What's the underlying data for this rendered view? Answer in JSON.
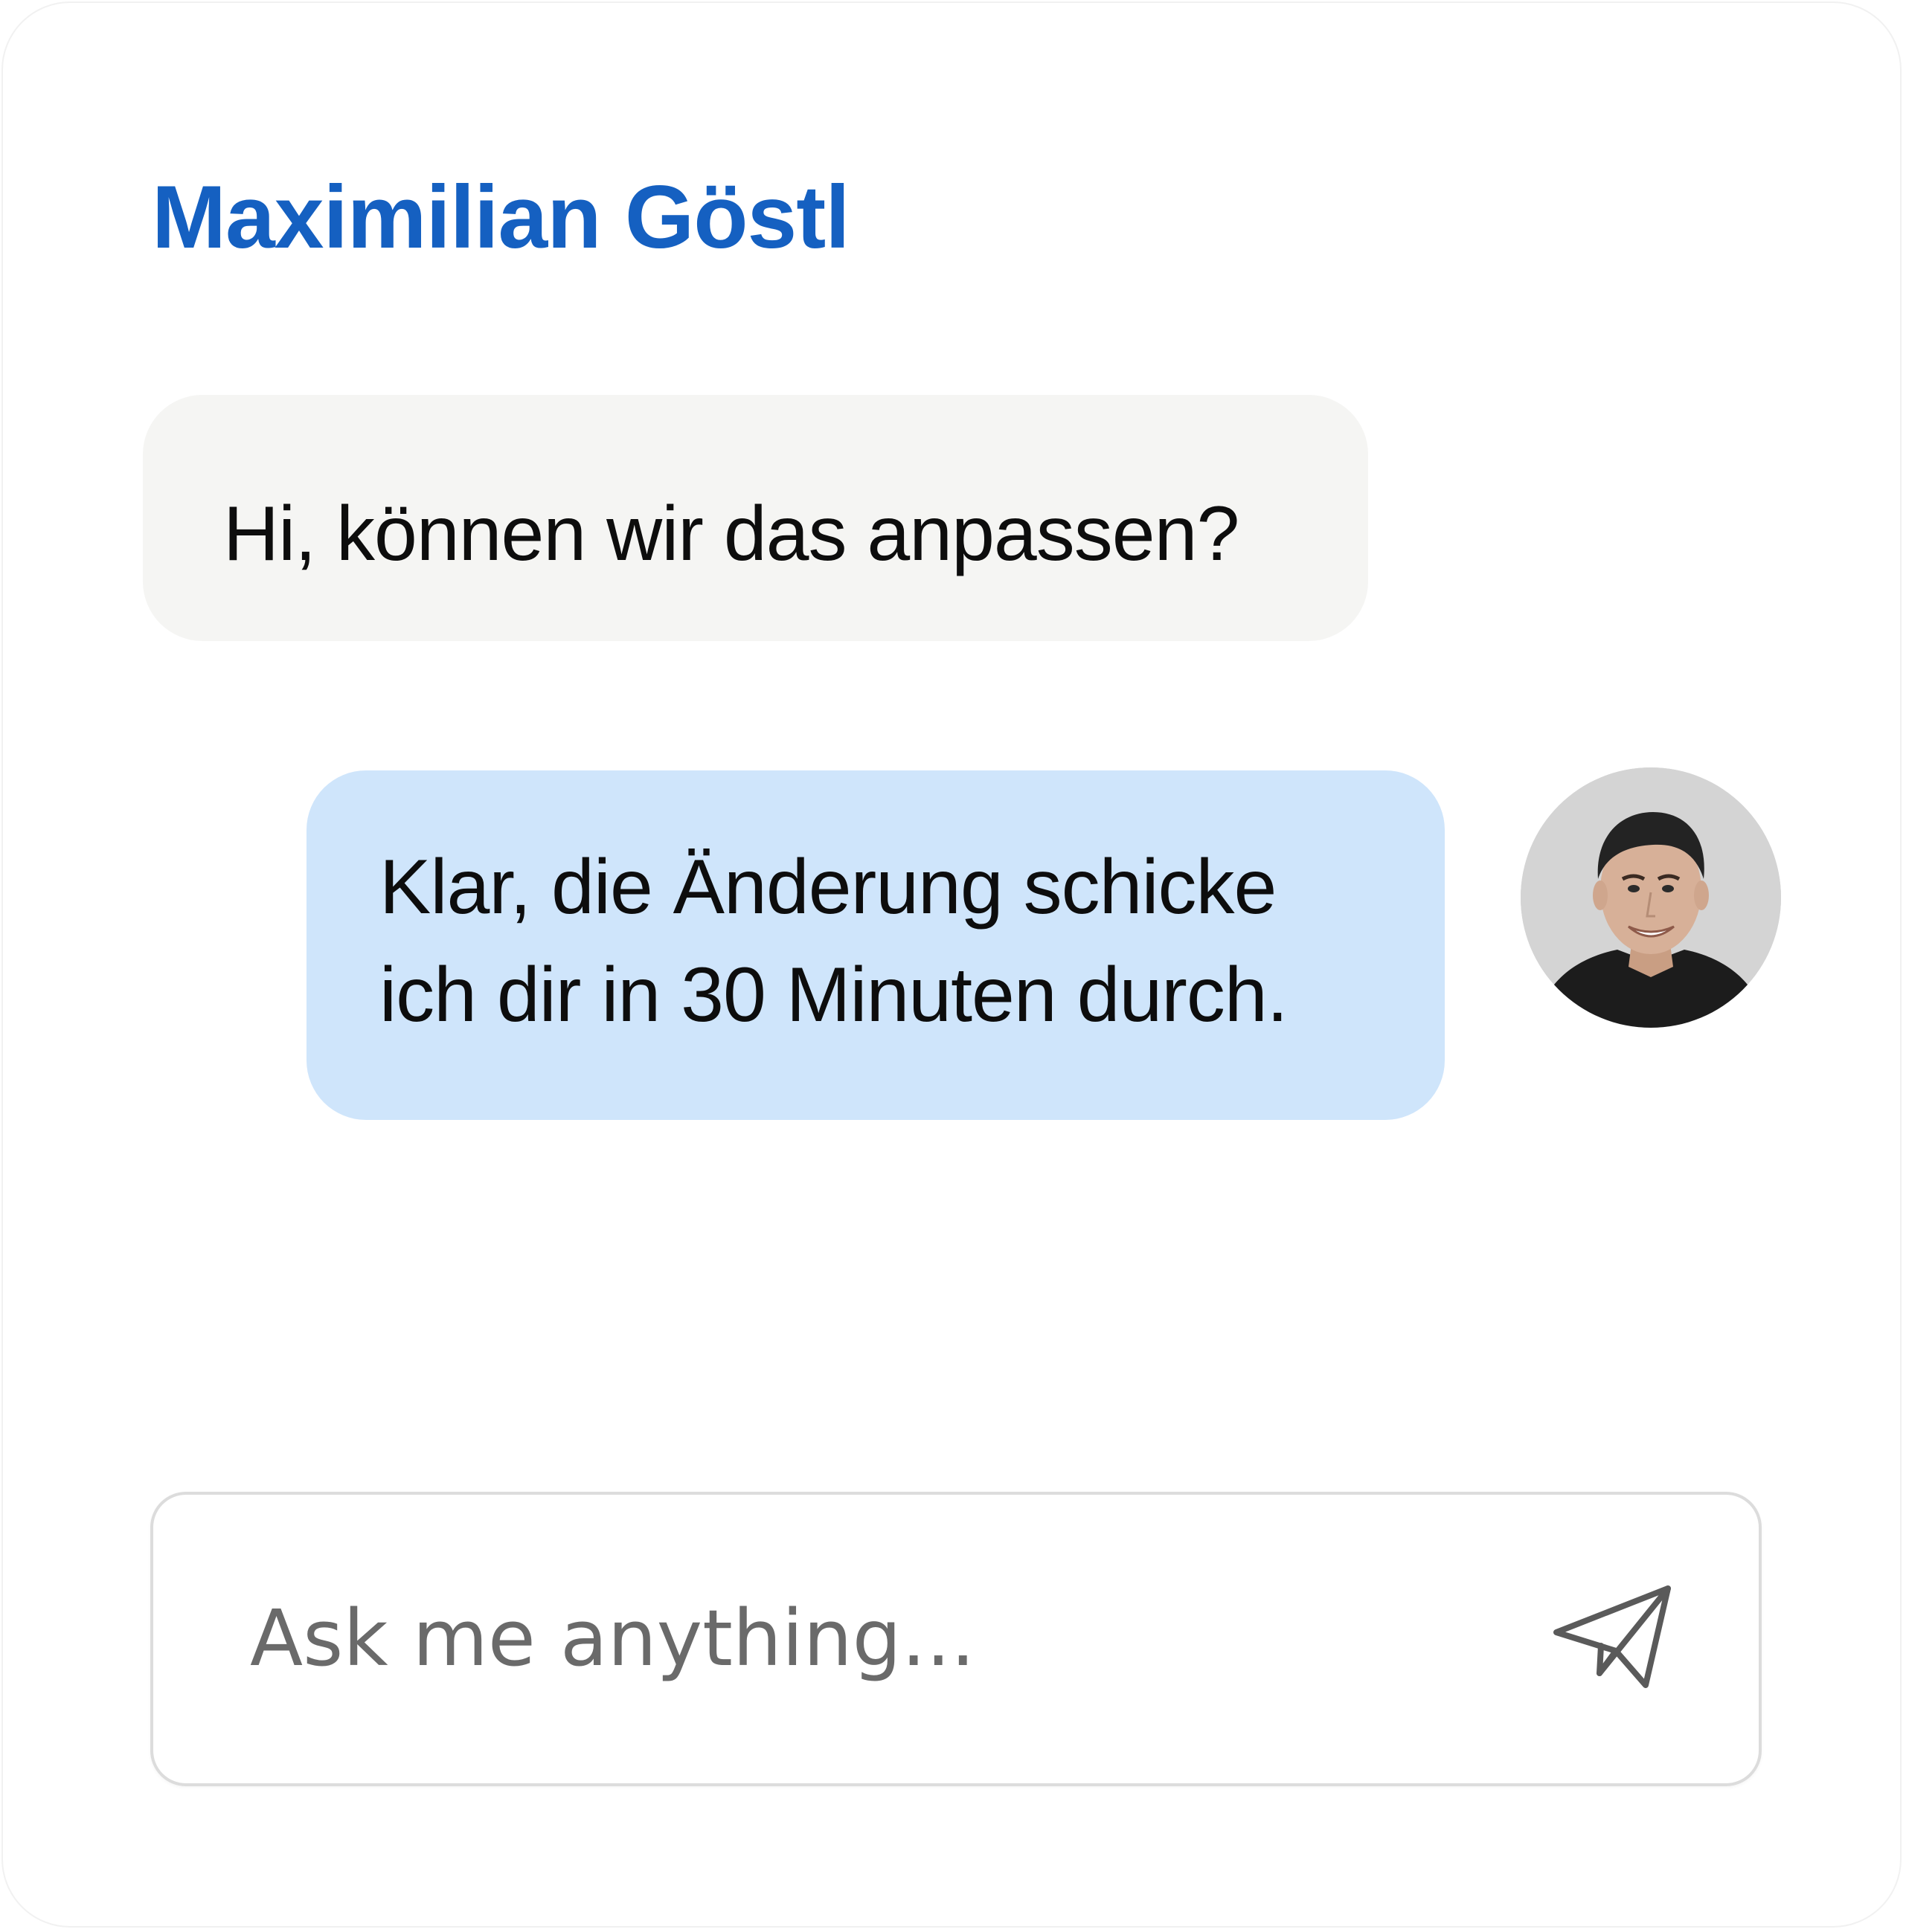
{
  "chat": {
    "contact_name": "Maximilian Göstl",
    "messages": [
      {
        "direction": "incoming",
        "text": "Hi, können wir das anpassen?"
      },
      {
        "direction": "outgoing",
        "lines": [
          "Klar, die Änderung schicke",
          "ich dir in 30 Minuten durch."
        ]
      }
    ],
    "avatar": {
      "icon": "user-photo-avatar"
    }
  },
  "composer": {
    "placeholder": "Ask me anything...",
    "send_icon": "paper-plane-icon"
  },
  "colors": {
    "name": "#1560c1",
    "incoming_bubble": "#f5f5f3",
    "outgoing_bubble": "#cfe5fb",
    "icon_stroke": "#5a5a5a"
  }
}
